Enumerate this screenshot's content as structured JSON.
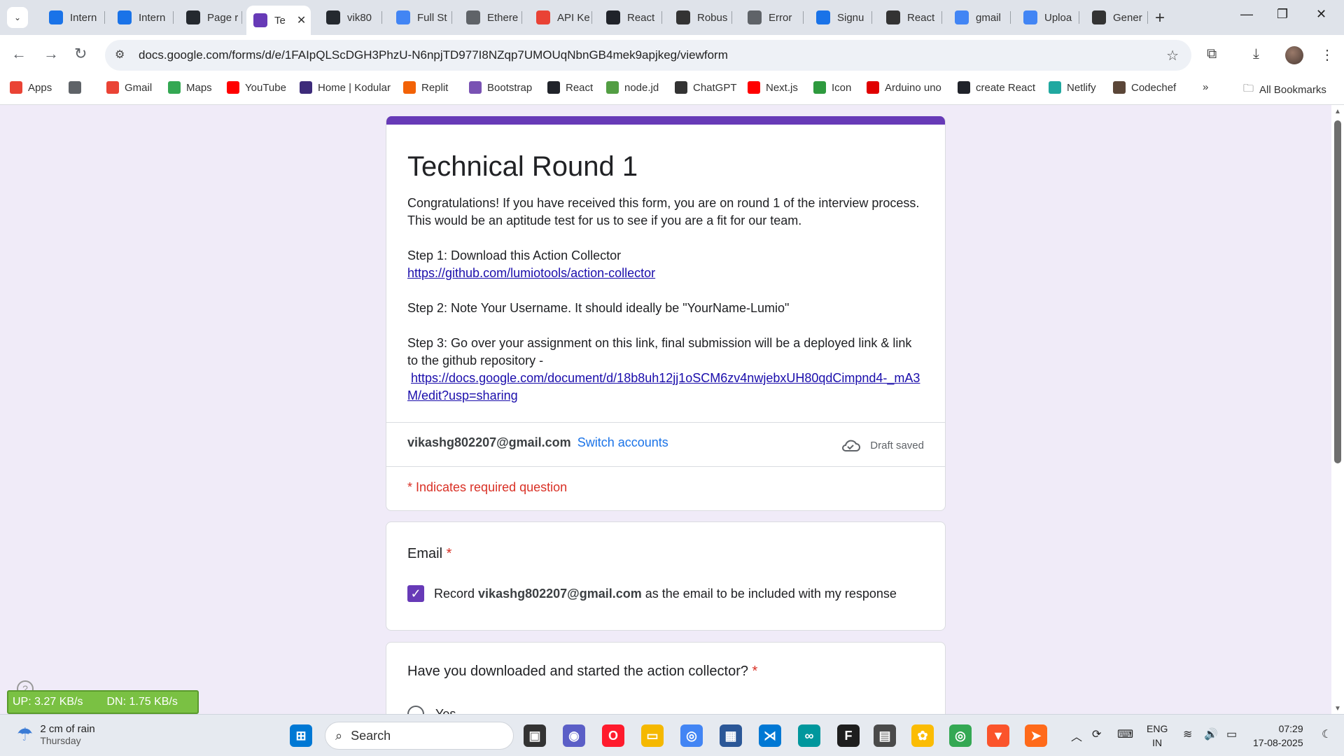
{
  "browser": {
    "tabs": [
      {
        "label": "Intern",
        "icon": "IS",
        "color": "#1a73e8"
      },
      {
        "label": "Intern",
        "icon": "IS",
        "color": "#1a73e8"
      },
      {
        "label": "Page r",
        "icon": "github",
        "color": "#24292f"
      },
      {
        "label": "Te",
        "icon": "forms",
        "color": "#673ab7",
        "active": true
      },
      {
        "label": "vik80",
        "icon": "github",
        "color": "#24292f"
      },
      {
        "label": "Full St",
        "icon": "docs",
        "color": "#4285f4"
      },
      {
        "label": "Ethere",
        "icon": "ethereum",
        "color": "#5f6368"
      },
      {
        "label": "API Ke",
        "icon": "9",
        "color": "#e94235"
      },
      {
        "label": "React",
        "icon": "react",
        "color": "#20232a"
      },
      {
        "label": "Robus",
        "icon": "mail",
        "color": "#333"
      },
      {
        "label": "Error",
        "icon": "globe",
        "color": "#5f6368"
      },
      {
        "label": "Signu",
        "icon": "signup",
        "color": "#1a73e8"
      },
      {
        "label": "React",
        "icon": "chatgpt",
        "color": "#333"
      },
      {
        "label": "gmail",
        "icon": "G",
        "color": "#4285f4"
      },
      {
        "label": "Uploa",
        "icon": "G",
        "color": "#4285f4"
      },
      {
        "label": "Gener",
        "icon": "chatgpt",
        "color": "#333"
      }
    ],
    "url": "docs.google.com/forms/d/e/1FAIpQLScDGH3PhzU-N6npjTD977I8NZqp7UMOUqNbnGB4mek9apjkeg/viewform",
    "bookmarks": [
      {
        "label": "Apps",
        "color": "#ea4335"
      },
      {
        "label": "",
        "color": "#5f6368"
      },
      {
        "label": "Gmail",
        "color": "#ea4335"
      },
      {
        "label": "Maps",
        "color": "#34a853"
      },
      {
        "label": "YouTube",
        "color": "#ff0000"
      },
      {
        "label": "Home | Kodular",
        "color": "#3d2b7a"
      },
      {
        "label": "Replit",
        "color": "#f26207"
      },
      {
        "label": "Bootstrap",
        "color": "#7952b3"
      },
      {
        "label": "React",
        "color": "#20232a"
      },
      {
        "label": "node.jd",
        "color": "#539e43"
      },
      {
        "label": "ChatGPT",
        "color": "#333333"
      },
      {
        "label": "Next.js",
        "color": "#ff0000"
      },
      {
        "label": "Icon",
        "color": "#2e9a3e"
      },
      {
        "label": "Arduino uno",
        "color": "#e00000"
      },
      {
        "label": "create React",
        "color": "#20232a"
      },
      {
        "label": "Netlify",
        "color": "#20a8a0"
      },
      {
        "label": "Codechef",
        "color": "#5b4638"
      }
    ],
    "all_bookmarks": "All Bookmarks"
  },
  "form": {
    "title": "Technical Round 1",
    "description": {
      "intro": "Congratulations! If you have received this form, you are on round 1 of the interview process. This would be an aptitude test for us to see if you are a fit for our team.",
      "step1": "Step 1: Download this Action Collector",
      "step1_link": "https://github.com/lumiotools/action-collector",
      "step2": "Step 2: Note Your Username. It should ideally be \"YourName-Lumio\"",
      "step3": "Step 3: Go over your assignment on this link, final submission will be a deployed link & link to the github repository -",
      "step3_link": "https://docs.google.com/document/d/18b8uh12jj1oSCM6zv4nwjebxUH80qdCimpnd4-_mA3M/edit?usp=sharing"
    },
    "account_email": "vikashg802207@gmail.com",
    "switch_accounts": "Switch accounts",
    "draft_status": "Draft saved",
    "required_note": "* Indicates required question",
    "email_question": {
      "title": "Email",
      "required_mark": "*",
      "record_prefix": "Record",
      "record_email": "vikashg802207@gmail.com",
      "record_suffix": "as the email to be included with my response",
      "checked": true
    },
    "question2": {
      "title": "Have you downloaded and started the action collector?",
      "required_mark": "*",
      "option1": "Yes"
    }
  },
  "overlay": {
    "upload": "UP: 3.27 KB/s",
    "download": "DN: 1.75 KB/s"
  },
  "taskbar": {
    "weather_main": "2 cm of rain",
    "weather_day": "Thursday",
    "search_placeholder": "Search",
    "lang_line1": "ENG",
    "lang_line2": "IN",
    "time": "07:29",
    "date": "17-08-2025"
  }
}
